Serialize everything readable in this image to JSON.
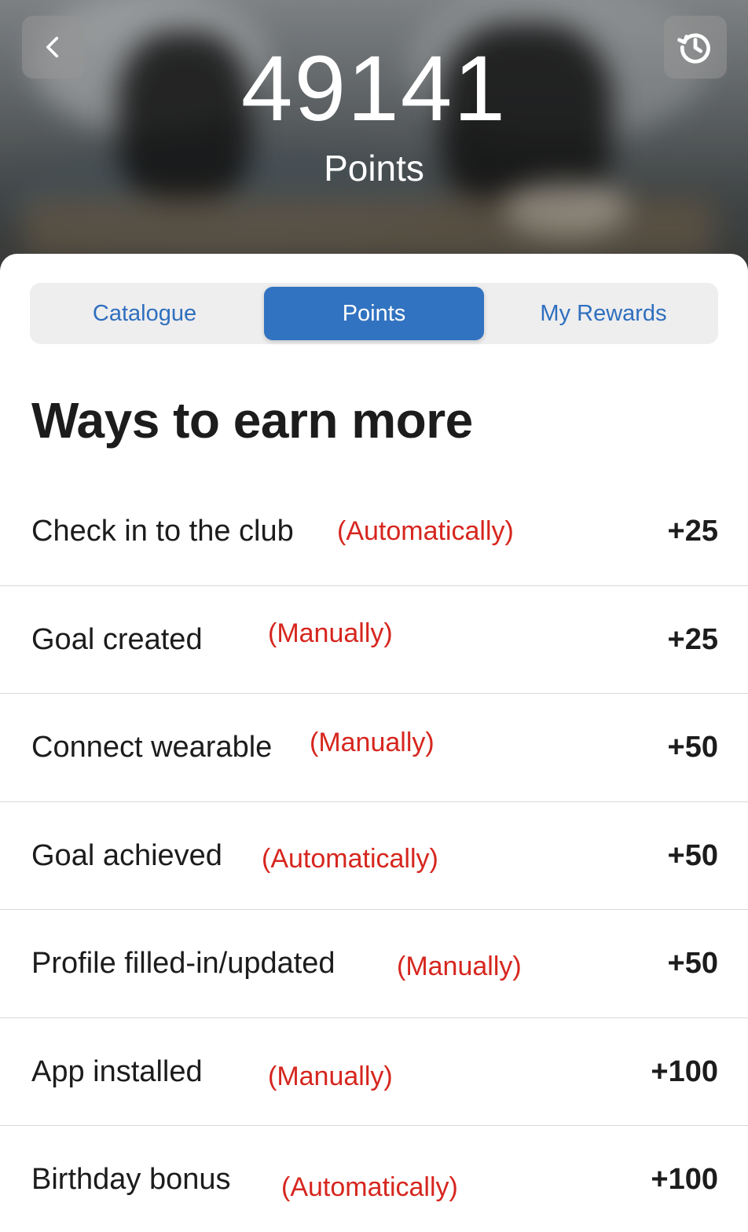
{
  "header": {
    "points_value": "49141",
    "points_caption": "Points",
    "back_icon": "chevron-left-icon",
    "history_icon": "history-icon"
  },
  "tabs": [
    {
      "label": "Catalogue",
      "selected": false
    },
    {
      "label": "Points",
      "selected": true
    },
    {
      "label": "My Rewards",
      "selected": false
    }
  ],
  "section": {
    "title": "Ways to earn more"
  },
  "earn_items": [
    {
      "label": "Check in to the club",
      "mode": "(Automatically)",
      "points": "+25"
    },
    {
      "label": "Goal created",
      "mode": "(Manually)",
      "points": "+25"
    },
    {
      "label": "Connect wearable",
      "mode": "(Manually)",
      "points": "+50"
    },
    {
      "label": "Goal achieved",
      "mode": "(Automatically)",
      "points": "+50"
    },
    {
      "label": "Profile filled-in/updated",
      "mode": "(Manually)",
      "points": "+50"
    },
    {
      "label": "App installed",
      "mode": "(Manually)",
      "points": "+100"
    },
    {
      "label": "Birthday bonus",
      "mode": "(Automatically)",
      "points": "+100"
    }
  ],
  "colors": {
    "accent": "#3173c1",
    "tab_text": "#2f6fbe",
    "annotation_red": "#d6261e",
    "divider": "#d9d9d9"
  }
}
